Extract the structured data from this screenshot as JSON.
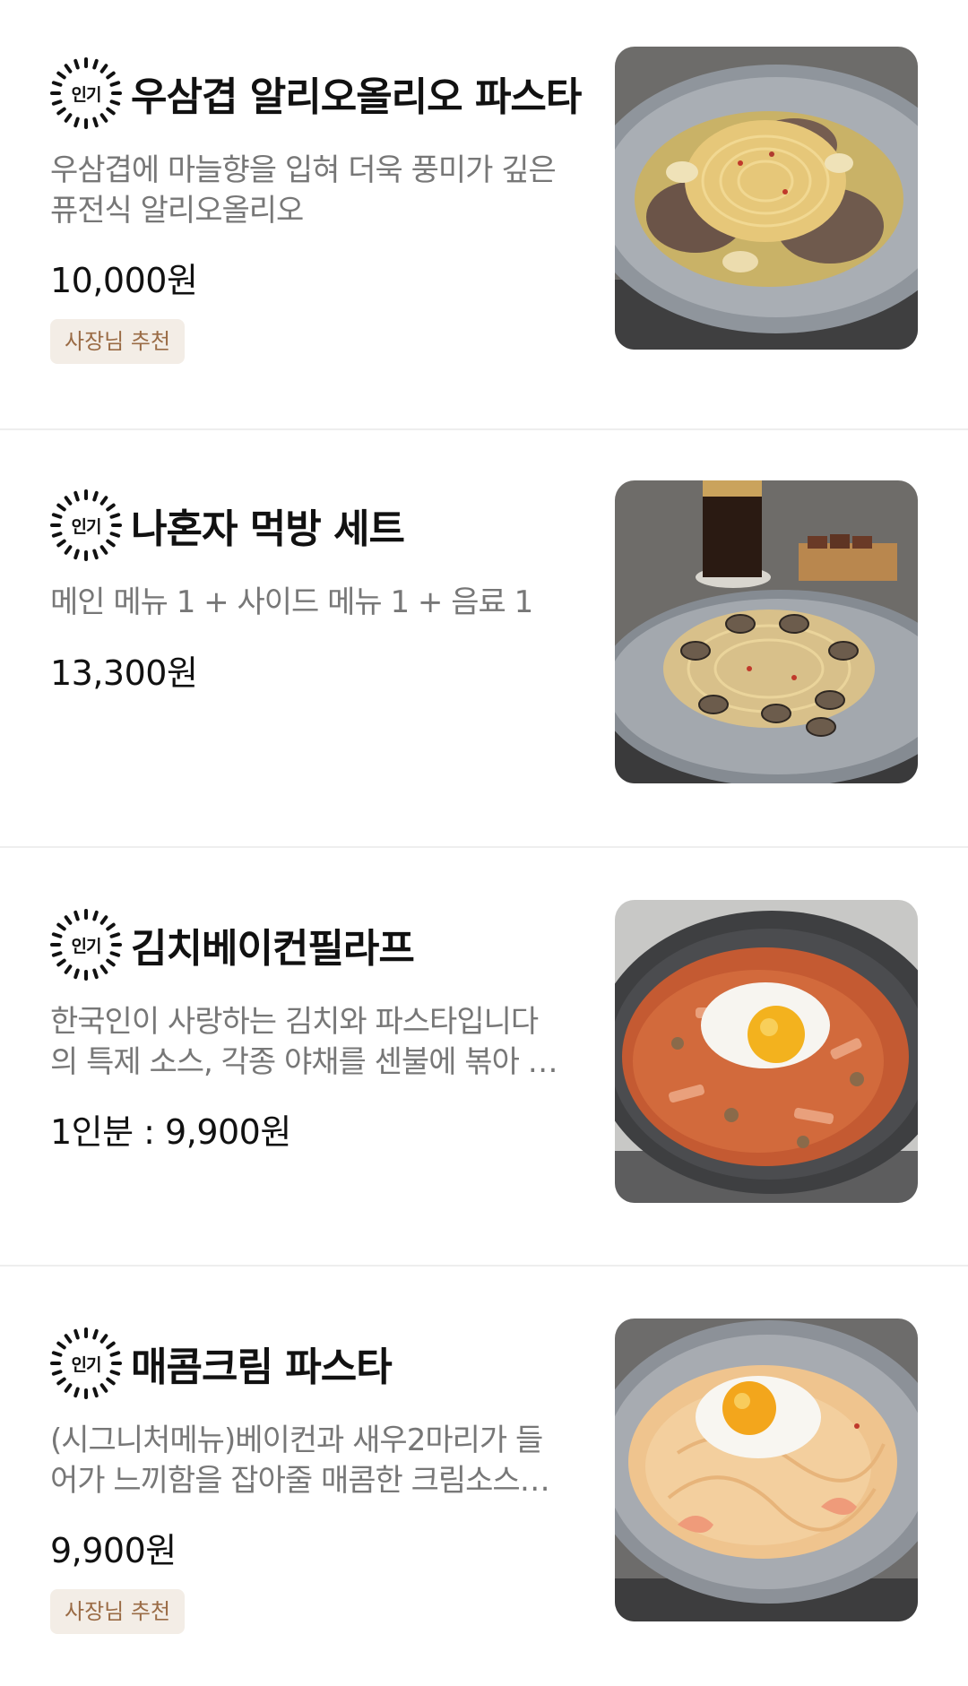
{
  "badge_label": "인기",
  "items": [
    {
      "title": "우삼겹 알리오올리오 파스타",
      "desc": [
        "우삼겹에 마늘향을 입혀 더욱 풍미가 깊은",
        "퓨전식 알리오올리오"
      ],
      "price": "10,000원",
      "tag": "사장님 추천",
      "photo_icon": "aglio-olio-pasta-photo"
    },
    {
      "title": "나혼자 먹방 세트",
      "desc": [
        "메인 메뉴 1 + 사이드 메뉴 1 + 음료 1"
      ],
      "price": "13,300원",
      "photo_icon": "clam-pasta-set-photo"
    },
    {
      "title": "김치베이컨필라프",
      "desc": [
        "한국인이 사랑하는 김치와 파스타입니다",
        "의 특제 소스, 각종 야채를 센불에 볶아 …"
      ],
      "price": "1인분 : 9,900원",
      "photo_icon": "kimchi-pilaf-photo"
    },
    {
      "title": "매콤크림 파스타",
      "desc": [
        "(시그니처메뉴)베이컨과 새우2마리가 들",
        "어가 느끼함을 잡아줄 매콤한 크림소스…"
      ],
      "price": "9,900원",
      "tag": "사장님 추천",
      "photo_icon": "spicy-cream-pasta-photo"
    }
  ],
  "colors": {
    "tag_bg": "#f3ede6",
    "tag_text": "#9a6b45",
    "desc_text": "#777777",
    "divider": "#eeeeee"
  }
}
